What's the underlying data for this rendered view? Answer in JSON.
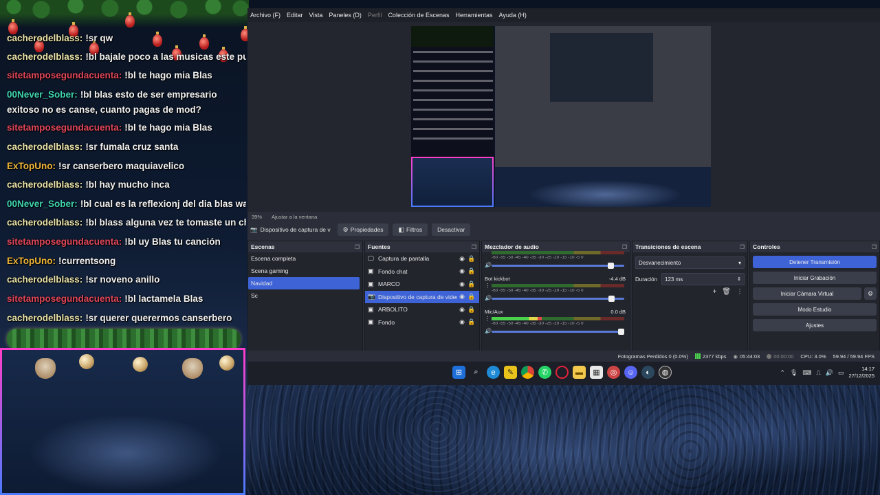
{
  "chat": {
    "lines": [
      {
        "user": "cacherodelblass:",
        "user_color": "#e8e2a8",
        "text": "!sr qw"
      },
      {
        "user": "cacherodelblass:",
        "user_color": "#e8e2a8",
        "text": "!bl bajale poco a las musicas este puro"
      },
      {
        "user": "sitetamposegundacuenta:",
        "user_color": "#e0465a",
        "text": "!bl te hago mia Blas"
      },
      {
        "user": "00Never_Sober:",
        "user_color": "#3fd6b0",
        "text": "!bl blas esto de ser empresario exitoso no es canse, cuanto pagas de mod?"
      },
      {
        "user": "sitetamposegundacuenta:",
        "user_color": "#e0465a",
        "text": "!bl te hago mia Blas"
      },
      {
        "user": "cacherodelblass:",
        "user_color": "#e8e2a8",
        "text": "!sr fumala cruz santa"
      },
      {
        "user": "ExTopUno:",
        "user_color": "#f0b638",
        "text": "!sr canserbero maquiavelico"
      },
      {
        "user": "cacherodelblass:",
        "user_color": "#e8e2a8",
        "text": "!bl hay mucho inca"
      },
      {
        "user": "00Never_Sober:",
        "user_color": "#3fd6b0",
        "text": "!bl cual es la reflexionj del dia blas wano"
      },
      {
        "user": "cacherodelblass:",
        "user_color": "#e8e2a8",
        "text": "!bl blass alguna vez te tomaste un chimbor"
      },
      {
        "user": "sitetamposegundacuenta:",
        "user_color": "#e0465a",
        "text": "!bl uy Blas tu canción"
      },
      {
        "user": "ExTopUno:",
        "user_color": "#f0b638",
        "text": "!currentsong"
      },
      {
        "user": "cacherodelblass:",
        "user_color": "#e8e2a8",
        "text": "!sr noveno anillo"
      },
      {
        "user": "sitetamposegundacuenta:",
        "user_color": "#e0465a",
        "text": "!bl lactamela Blas"
      },
      {
        "user": "cacherodelblass:",
        "user_color": "#e8e2a8",
        "text": "!sr querer querermos canserbero"
      }
    ]
  },
  "obs": {
    "menu": [
      "Archivo (F)",
      "Editar",
      "Vista",
      "Paneles (D)",
      "Perfil",
      "Colección de Escenas",
      "Herramientas",
      "Ayuda (H)"
    ],
    "menu_disabled": "Perfil",
    "preview_toolbar": {
      "zoom": "39%",
      "fit": "Ajustar a la ventana"
    },
    "source_toolbar": {
      "selected_source": "Dispositivo de captura de v",
      "properties": "Propiedades",
      "filters": "Filtros",
      "deactivate": "Desactivar"
    },
    "scenes": {
      "title": "Escenas",
      "items": [
        "Escena completa",
        "Scena gaming",
        "Navidad",
        "Sc"
      ],
      "selected": "Navidad"
    },
    "sources": {
      "title": "Fuentes",
      "items": [
        {
          "name": "Captura de pantalla",
          "icon": "monitor-icon"
        },
        {
          "name": "Fondo chat",
          "icon": "image-icon"
        },
        {
          "name": "MARCO",
          "icon": "image-icon"
        },
        {
          "name": "Dispositivo de captura de video",
          "icon": "camera-icon",
          "selected": true
        },
        {
          "name": "ARBOLITO",
          "icon": "image-icon"
        },
        {
          "name": "Fondo",
          "icon": "image-icon"
        }
      ]
    },
    "mixer": {
      "title": "Mezclador de audio",
      "scale": "-60 -55 -50 -45 -40 -35 -30 -25 -20 -15 -10 -5 0",
      "channels": [
        {
          "name": "",
          "db": "",
          "level": 0.0,
          "fader": 0.92
        },
        {
          "name": "Bot kickbot",
          "db": "-4.4 dB",
          "level": 0.0,
          "fader": 0.93
        },
        {
          "name": "Mic/Aux",
          "db": "0.0 dB",
          "level": 0.38,
          "fader": 1.0
        }
      ]
    },
    "transitions": {
      "title": "Transiciones de escena",
      "selected": "Desvanecimiento",
      "duration_label": "Duración",
      "duration_value": "123 ms"
    },
    "controls": {
      "title": "Controles",
      "stop_stream": "Detener Transmisión",
      "start_recording": "Iniciar Grabación",
      "virtual_cam": "Iniciar Cámara Virtual",
      "studio_mode": "Modo Estudio",
      "settings": "Ajustes"
    },
    "status": {
      "dropped": "Fotogramas Perdidos 0 (0.0%)",
      "bitrate": "2377 kbps",
      "stream_time": "05:44:03",
      "rec_time": "00:00:00",
      "cpu": "CPU: 3.0%",
      "fps": "59.94 / 59.94 FPS"
    }
  },
  "taskbar": {
    "time": "14:17",
    "date": "27/12/2025",
    "icons": [
      "windows-icon",
      "search-icon",
      "edge-icon",
      "sticky-icon",
      "chrome-icon",
      "whatsapp-icon",
      "opera-icon",
      "folder-icon",
      "store-icon",
      "app-icon",
      "discord-icon",
      "steam-icon",
      "obs-icon"
    ]
  }
}
